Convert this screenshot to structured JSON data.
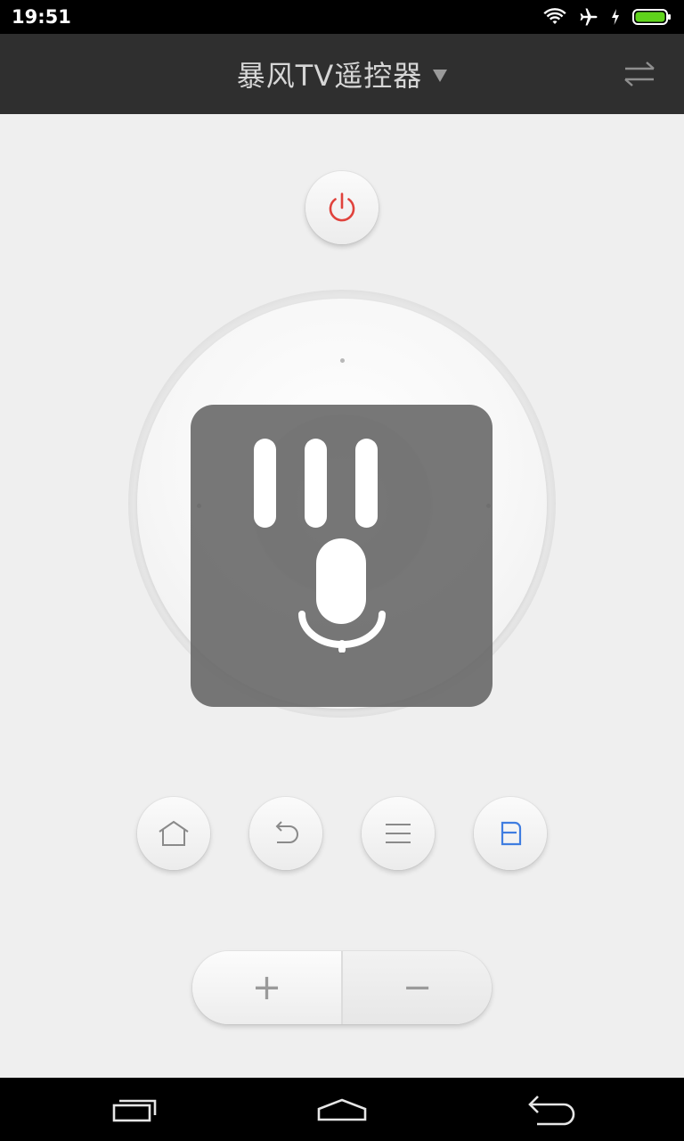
{
  "status_bar": {
    "time": "19:51",
    "icons": [
      "wifi-icon",
      "airplane-icon",
      "charging-icon",
      "battery-icon"
    ],
    "battery_color": "#5fd31c"
  },
  "header": {
    "title": "暴风TV遥控器",
    "dropdown_icon": "caret-down-icon",
    "switch_icon": "switch-arrows-icon"
  },
  "remote": {
    "power_icon": "power-icon",
    "power_color": "#e0423c",
    "dpad": {
      "directions": [
        "up",
        "down",
        "left",
        "right"
      ],
      "center": "ok"
    },
    "voice_overlay": {
      "icon": "microphone-icon",
      "level_bars": 3
    },
    "function_buttons": [
      {
        "name": "home",
        "icon": "home-icon",
        "color": "#8a8a8a"
      },
      {
        "name": "back",
        "icon": "back-icon",
        "color": "#8a8a8a"
      },
      {
        "name": "menu",
        "icon": "menu-icon",
        "color": "#8a8a8a"
      },
      {
        "name": "baofeng",
        "icon": "baofeng-logo-icon",
        "color": "#3f7de0"
      }
    ],
    "volume": {
      "plus_label": "+",
      "minus_label": "−"
    }
  },
  "nav_bar": {
    "buttons": [
      "recent-apps-icon",
      "home-icon",
      "back-icon"
    ]
  }
}
